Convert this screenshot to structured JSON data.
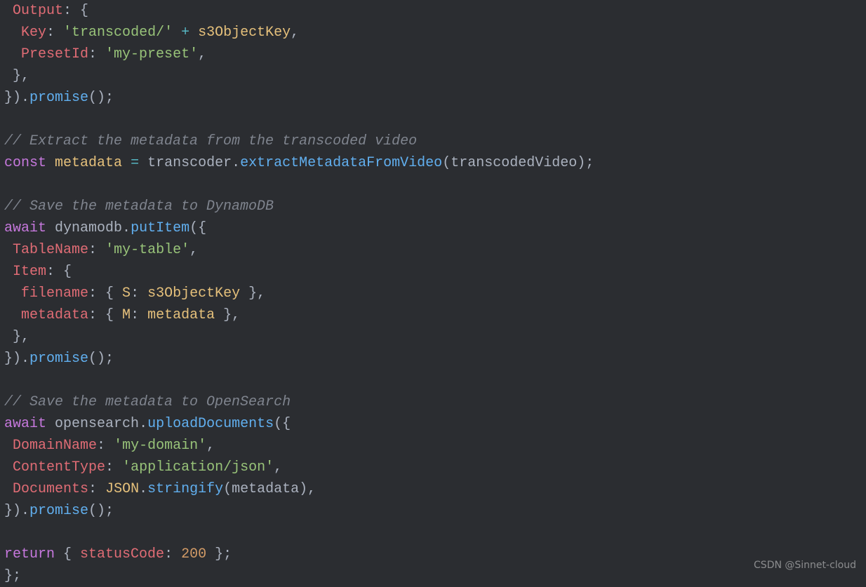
{
  "code": {
    "lines": [
      {
        "tokens": [
          {
            "t": " ",
            "c": "pu"
          },
          {
            "t": "Output",
            "c": "pc"
          },
          {
            "t": ": {",
            "c": "pu"
          }
        ]
      },
      {
        "tokens": [
          {
            "t": "  ",
            "c": "pu"
          },
          {
            "t": "Key",
            "c": "pc"
          },
          {
            "t": ": ",
            "c": "pu"
          },
          {
            "t": "'transcoded/'",
            "c": "s"
          },
          {
            "t": " + ",
            "c": "op"
          },
          {
            "t": "s3ObjectKey",
            "c": "v"
          },
          {
            "t": ",",
            "c": "pu"
          }
        ]
      },
      {
        "tokens": [
          {
            "t": "  ",
            "c": "pu"
          },
          {
            "t": "PresetId",
            "c": "pc"
          },
          {
            "t": ": ",
            "c": "pu"
          },
          {
            "t": "'my-preset'",
            "c": "s"
          },
          {
            "t": ",",
            "c": "pu"
          }
        ]
      },
      {
        "tokens": [
          {
            "t": " },",
            "c": "pu"
          }
        ]
      },
      {
        "tokens": [
          {
            "t": "}).",
            "c": "pu"
          },
          {
            "t": "promise",
            "c": "fn"
          },
          {
            "t": "();",
            "c": "pu"
          }
        ]
      }
    ],
    "comment1": "// Extract the metadata from the transcoded video",
    "lines2": [
      {
        "tokens": [
          {
            "t": "const",
            "c": "k"
          },
          {
            "t": " ",
            "c": "pu"
          },
          {
            "t": "metadata",
            "c": "v"
          },
          {
            "t": " ",
            "c": "pu"
          },
          {
            "t": "=",
            "c": "op"
          },
          {
            "t": " ",
            "c": "pu"
          },
          {
            "t": "transcoder",
            "c": "id"
          },
          {
            "t": ".",
            "c": "pu"
          },
          {
            "t": "extractMetadataFromVideo",
            "c": "fn"
          },
          {
            "t": "(",
            "c": "pu"
          },
          {
            "t": "transcodedVideo",
            "c": "id"
          },
          {
            "t": ");",
            "c": "pu"
          }
        ]
      }
    ],
    "comment2": "// Save the metadata to DynamoDB",
    "lines3": [
      {
        "tokens": [
          {
            "t": "await",
            "c": "k"
          },
          {
            "t": " ",
            "c": "pu"
          },
          {
            "t": "dynamodb",
            "c": "id"
          },
          {
            "t": ".",
            "c": "pu"
          },
          {
            "t": "putItem",
            "c": "fn"
          },
          {
            "t": "({",
            "c": "pu"
          }
        ]
      },
      {
        "tokens": [
          {
            "t": " ",
            "c": "pu"
          },
          {
            "t": "TableName",
            "c": "pc"
          },
          {
            "t": ": ",
            "c": "pu"
          },
          {
            "t": "'my-table'",
            "c": "s"
          },
          {
            "t": ",",
            "c": "pu"
          }
        ]
      },
      {
        "tokens": [
          {
            "t": " ",
            "c": "pu"
          },
          {
            "t": "Item",
            "c": "pc"
          },
          {
            "t": ": {",
            "c": "pu"
          }
        ]
      },
      {
        "tokens": [
          {
            "t": "  ",
            "c": "pu"
          },
          {
            "t": "filename",
            "c": "pc"
          },
          {
            "t": ": { ",
            "c": "pu"
          },
          {
            "t": "S",
            "c": "v"
          },
          {
            "t": ": ",
            "c": "pu"
          },
          {
            "t": "s3ObjectKey",
            "c": "v"
          },
          {
            "t": " },",
            "c": "pu"
          }
        ]
      },
      {
        "tokens": [
          {
            "t": "  ",
            "c": "pu"
          },
          {
            "t": "metadata",
            "c": "pc"
          },
          {
            "t": ": { ",
            "c": "pu"
          },
          {
            "t": "M",
            "c": "v"
          },
          {
            "t": ": ",
            "c": "pu"
          },
          {
            "t": "metadata",
            "c": "v"
          },
          {
            "t": " },",
            "c": "pu"
          }
        ]
      },
      {
        "tokens": [
          {
            "t": " },",
            "c": "pu"
          }
        ]
      },
      {
        "tokens": [
          {
            "t": "}).",
            "c": "pu"
          },
          {
            "t": "promise",
            "c": "fn"
          },
          {
            "t": "();",
            "c": "pu"
          }
        ]
      }
    ],
    "comment3": "// Save the metadata to OpenSearch",
    "lines4": [
      {
        "tokens": [
          {
            "t": "await",
            "c": "k"
          },
          {
            "t": " ",
            "c": "pu"
          },
          {
            "t": "opensearch",
            "c": "id"
          },
          {
            "t": ".",
            "c": "pu"
          },
          {
            "t": "uploadDocuments",
            "c": "fn"
          },
          {
            "t": "({",
            "c": "pu"
          }
        ]
      },
      {
        "tokens": [
          {
            "t": " ",
            "c": "pu"
          },
          {
            "t": "DomainName",
            "c": "pc"
          },
          {
            "t": ": ",
            "c": "pu"
          },
          {
            "t": "'my-domain'",
            "c": "s"
          },
          {
            "t": ",",
            "c": "pu"
          }
        ]
      },
      {
        "tokens": [
          {
            "t": " ",
            "c": "pu"
          },
          {
            "t": "ContentType",
            "c": "pc"
          },
          {
            "t": ": ",
            "c": "pu"
          },
          {
            "t": "'application/json'",
            "c": "s"
          },
          {
            "t": ",",
            "c": "pu"
          }
        ]
      },
      {
        "tokens": [
          {
            "t": " ",
            "c": "pu"
          },
          {
            "t": "Documents",
            "c": "pc"
          },
          {
            "t": ": ",
            "c": "pu"
          },
          {
            "t": "JSON",
            "c": "v"
          },
          {
            "t": ".",
            "c": "pu"
          },
          {
            "t": "stringify",
            "c": "fn"
          },
          {
            "t": "(",
            "c": "pu"
          },
          {
            "t": "metadata",
            "c": "id"
          },
          {
            "t": "),",
            "c": "pu"
          }
        ]
      },
      {
        "tokens": [
          {
            "t": "}).",
            "c": "pu"
          },
          {
            "t": "promise",
            "c": "fn"
          },
          {
            "t": "();",
            "c": "pu"
          }
        ]
      }
    ],
    "lines5": [
      {
        "tokens": [
          {
            "t": "return",
            "c": "k"
          },
          {
            "t": " { ",
            "c": "pu"
          },
          {
            "t": "statusCode",
            "c": "pc"
          },
          {
            "t": ": ",
            "c": "pu"
          },
          {
            "t": "200",
            "c": "n"
          },
          {
            "t": " };",
            "c": "pu"
          }
        ]
      },
      {
        "tokens": [
          {
            "t": "};",
            "c": "pu"
          }
        ]
      }
    ]
  },
  "watermark": "CSDN @Sinnet-cloud"
}
